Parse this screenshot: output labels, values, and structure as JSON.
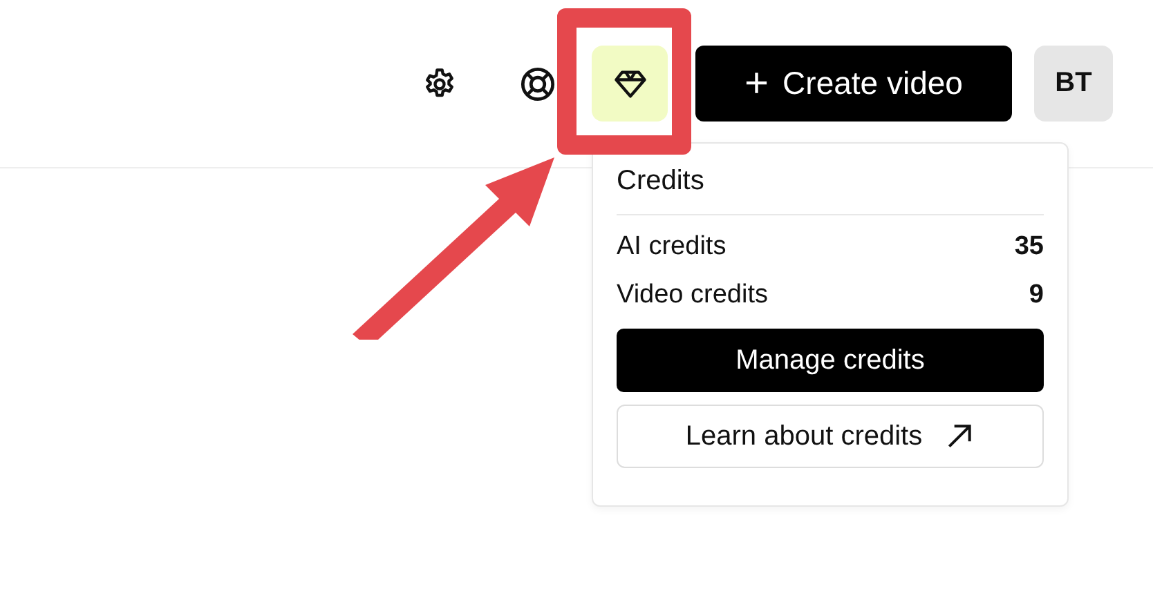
{
  "header": {
    "credits_button": {
      "active": true
    },
    "create_button": {
      "icon": "+",
      "label": "Create video"
    },
    "avatar": {
      "initials": "BT"
    }
  },
  "credits_popover": {
    "title": "Credits",
    "rows": [
      {
        "label": "AI credits",
        "value": "35"
      },
      {
        "label": "Video credits",
        "value": "9"
      }
    ],
    "primary_button": "Manage credits",
    "secondary_button": "Learn about credits"
  }
}
